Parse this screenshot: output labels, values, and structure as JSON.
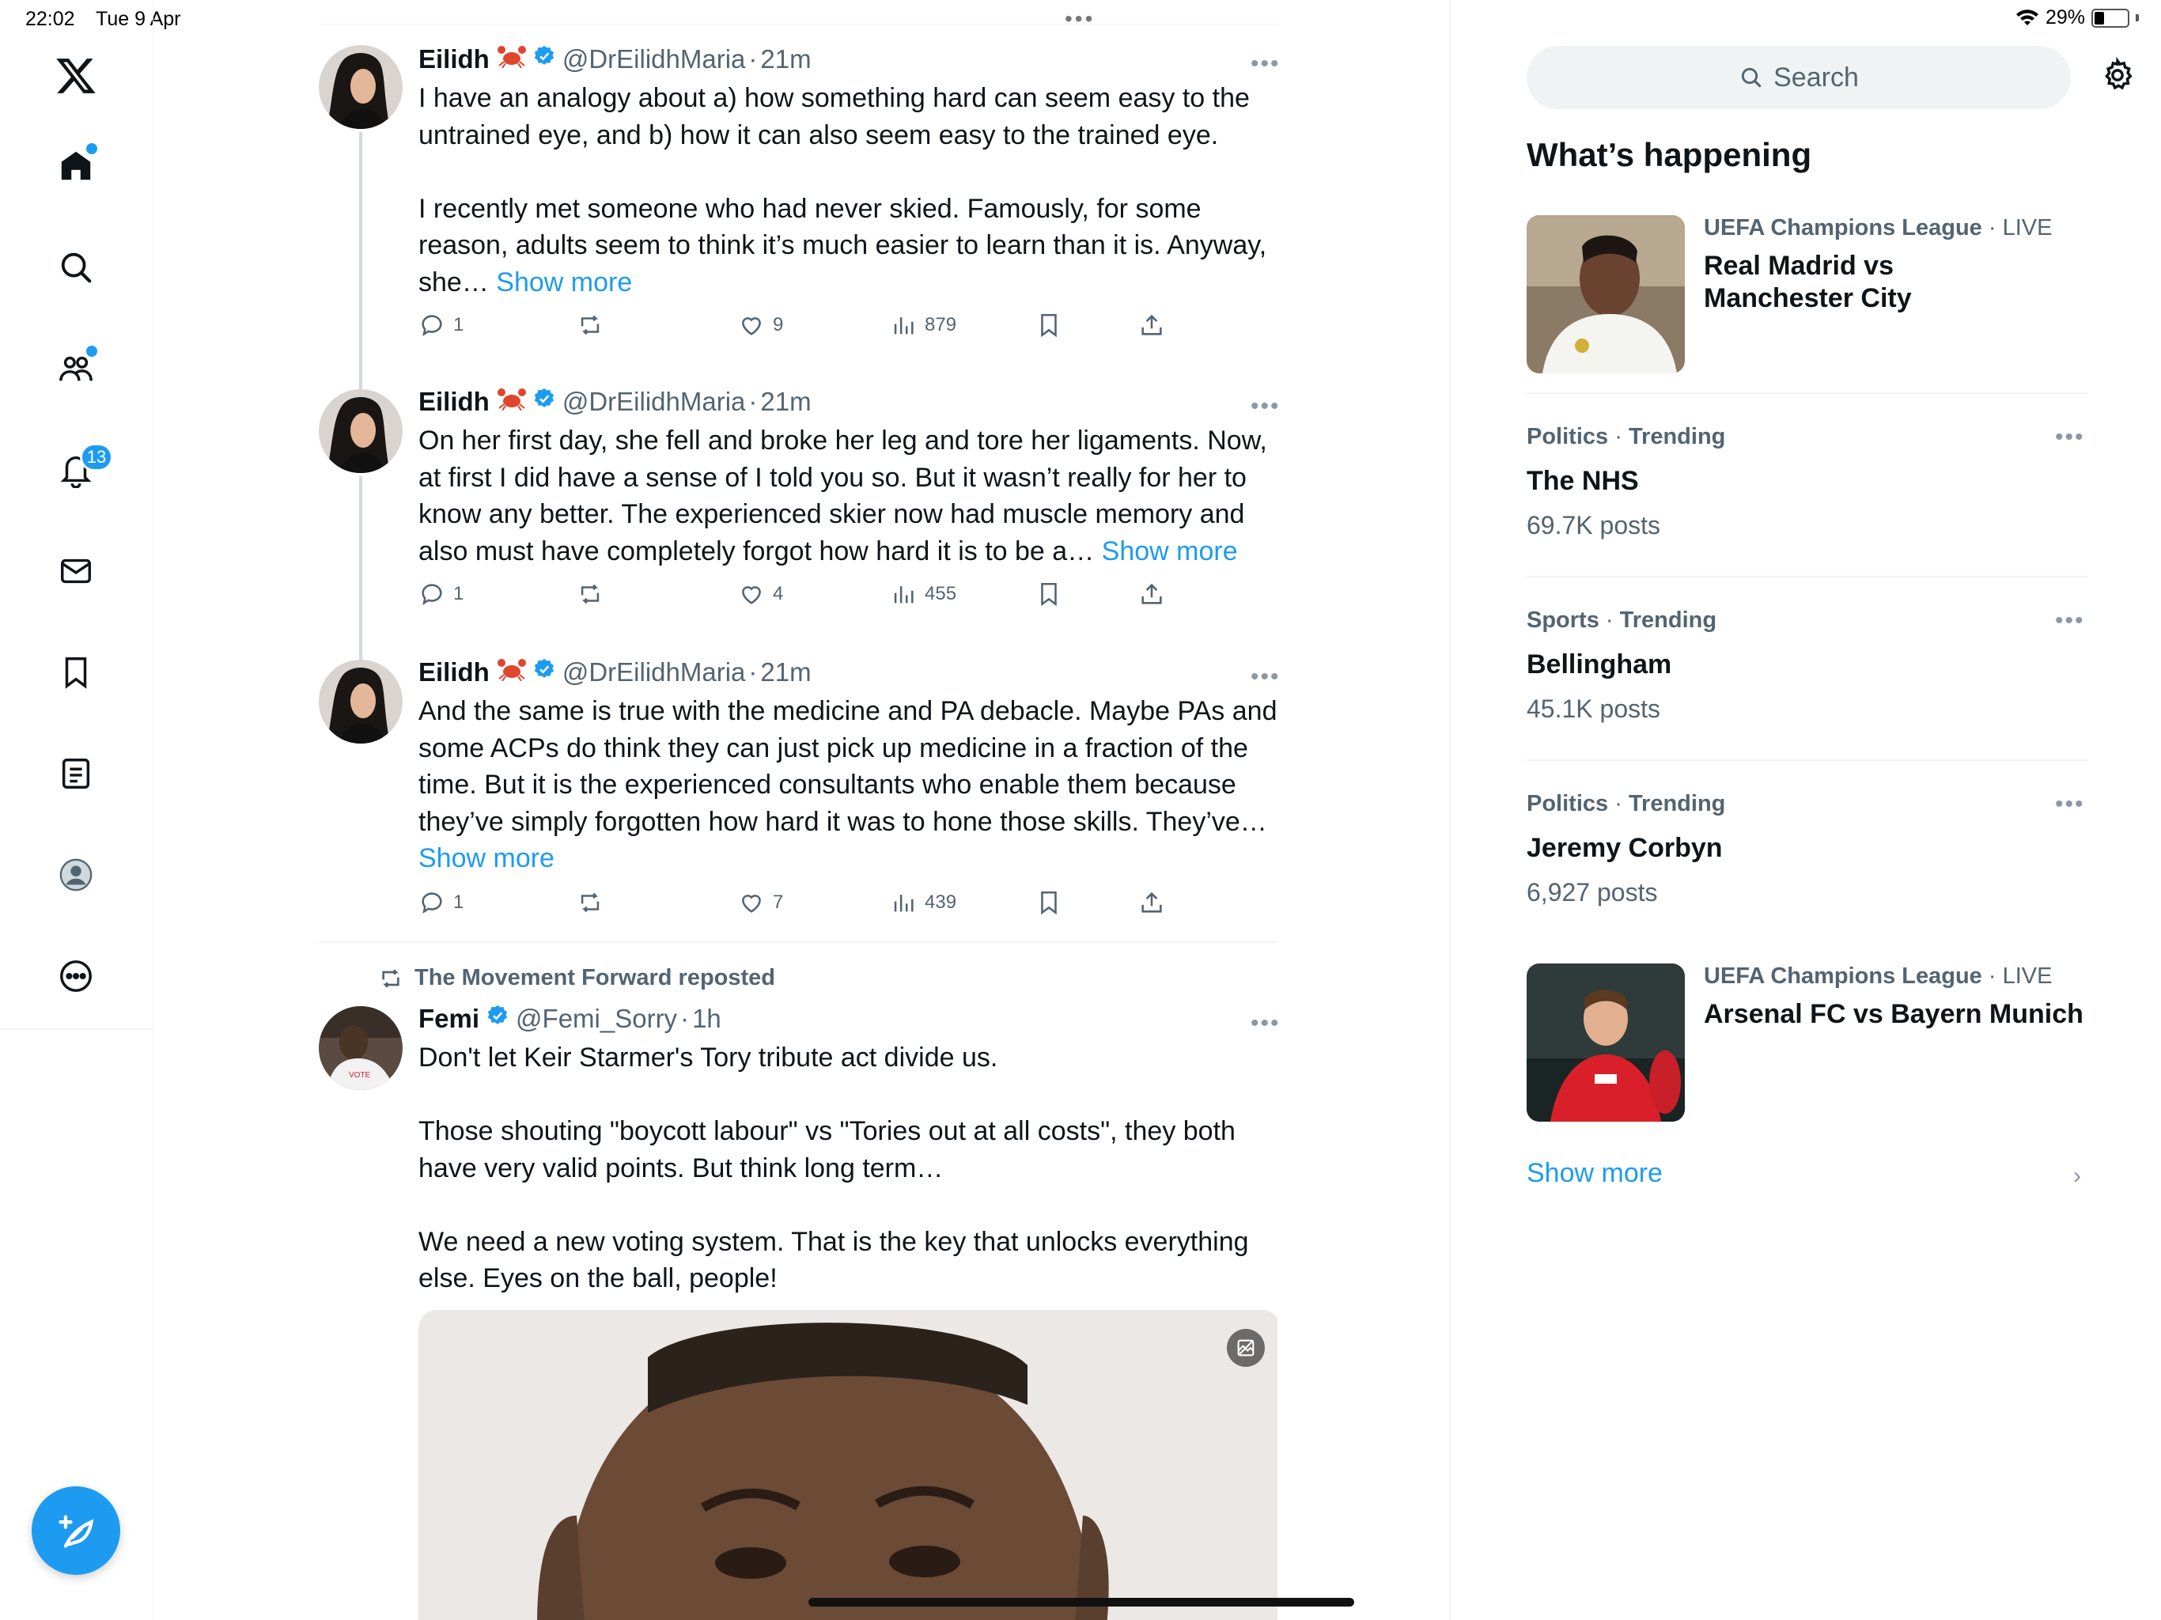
{
  "status": {
    "time": "22:02",
    "date": "Tue 9 Apr",
    "battery": "29%",
    "battery_level": 0.29
  },
  "nav": {
    "notifications_badge": "13"
  },
  "tweets": [
    {
      "name": "Eilidh",
      "handle": "@DrEilidhMaria",
      "time": "21m",
      "text": "I have an analogy about a) how something hard can seem easy to the untrained eye, and b) how it can also seem easy to the trained eye.\n\nI recently met someone who had never skied. Famously, for some reason, adults seem to think it’s much easier to learn than it is. Anyway, she…",
      "show_more": "Show more",
      "replies": "1",
      "likes": "9",
      "views": "879"
    },
    {
      "name": "Eilidh",
      "handle": "@DrEilidhMaria",
      "time": "21m",
      "text": "On her first day, she fell and broke her leg and tore her ligaments. Now, at first I did have a sense of I told you so. But it wasn’t really for her to know any better. The experienced skier now had muscle memory and also must have completely forgot how hard it is to be a…",
      "show_more": "Show more",
      "replies": "1",
      "likes": "4",
      "views": "455"
    },
    {
      "name": "Eilidh",
      "handle": "@DrEilidhMaria",
      "time": "21m",
      "text": "And the same is true with the medicine and PA debacle. Maybe PAs and some ACPs do think they can just pick up medicine in a fraction of the time. But it is the experienced consultants who enable them because they’ve simply forgotten how hard it was to hone those skills. They’ve…",
      "show_more": "Show more",
      "replies": "1",
      "likes": "7",
      "views": "439"
    },
    {
      "repost_label": "The Movement Forward reposted",
      "name": "Femi",
      "handle": "@Femi_Sorry",
      "time": "1h",
      "text": "Don't let Keir Starmer's Tory tribute act divide us.\n\nThose shouting \"boycott labour\" vs \"Tories out at all costs\", they both have very valid points. But think long term…\n\nWe need a new voting system. That is the key that unlocks everything else. Eyes on the ball, people!"
    }
  ],
  "sidebar": {
    "search_placeholder": "Search",
    "title": "What’s happening",
    "trends": [
      {
        "category": "UEFA Champions League",
        "suffix": "LIVE",
        "title": "Real Madrid vs\nManchester City"
      },
      {
        "category": "Politics",
        "suffix": "Trending",
        "title": "The NHS",
        "count": "69.7K posts"
      },
      {
        "category": "Sports",
        "suffix": "Trending",
        "title": "Bellingham",
        "count": "45.1K posts"
      },
      {
        "category": "Politics",
        "suffix": "Trending",
        "title": "Jeremy Corbyn",
        "count": "6,927 posts"
      },
      {
        "category": "UEFA Champions League",
        "suffix": "LIVE",
        "title": "Arsenal FC vs Bayern Munich"
      }
    ],
    "show_more": "Show more"
  },
  "colors": {
    "accent": "#1d9bf0",
    "text": "#0f1419",
    "muted": "#536471"
  }
}
